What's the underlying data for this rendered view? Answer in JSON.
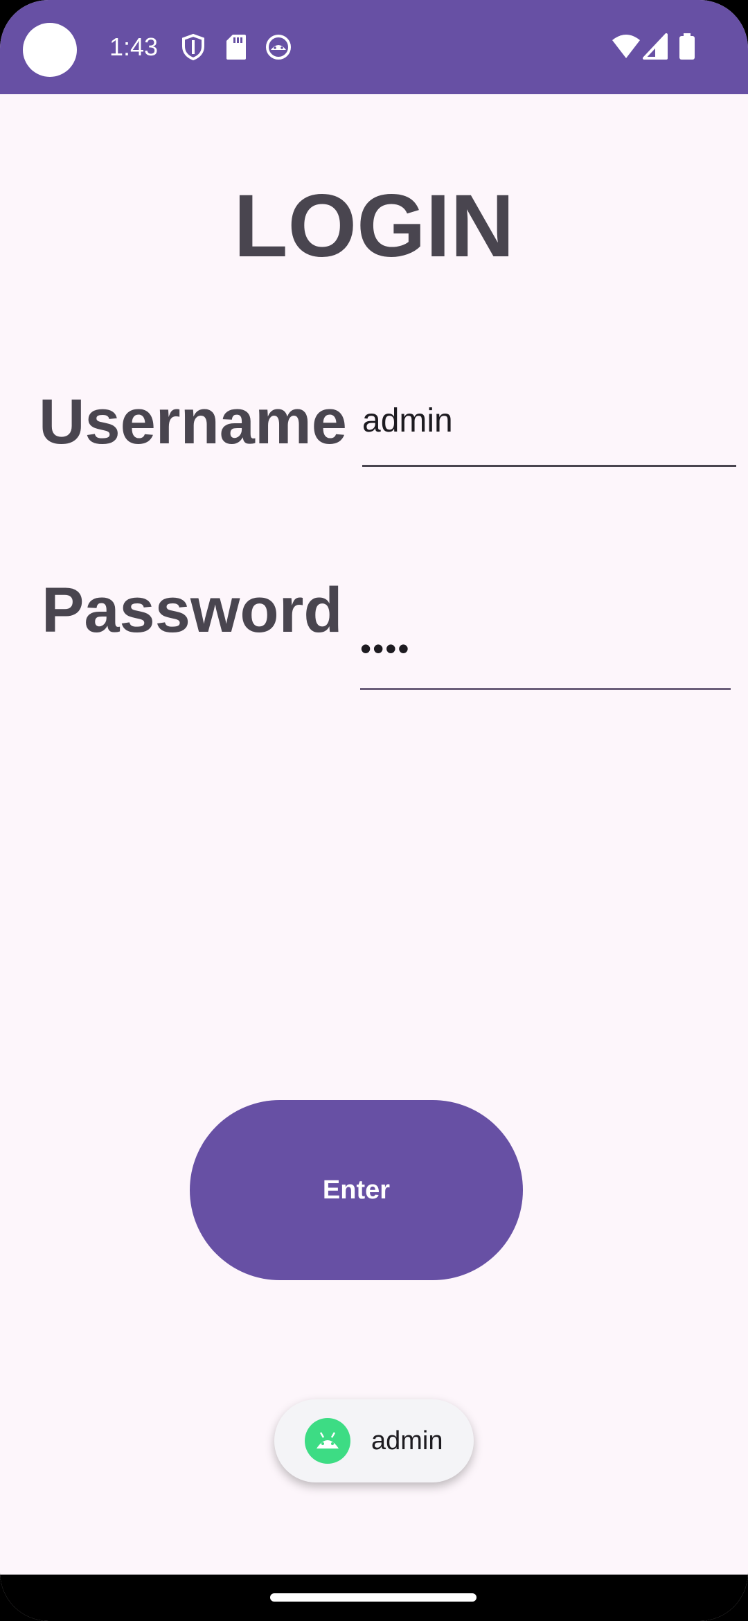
{
  "status_bar": {
    "time": "1:43",
    "background_color": "#6750A4",
    "icons_left": [
      "shield-icon",
      "sd-card-icon",
      "android-head-icon"
    ],
    "icons_right": [
      "wifi-icon",
      "signal-icon",
      "battery-icon"
    ]
  },
  "page": {
    "title": "LOGIN"
  },
  "form": {
    "username_label": "Username",
    "username_value": "admin",
    "password_label": "Password",
    "password_value": "••••"
  },
  "actions": {
    "enter_label": "Enter",
    "accent_color": "#6750A4"
  },
  "toast": {
    "icon": "android-app-icon",
    "message": "admin"
  }
}
